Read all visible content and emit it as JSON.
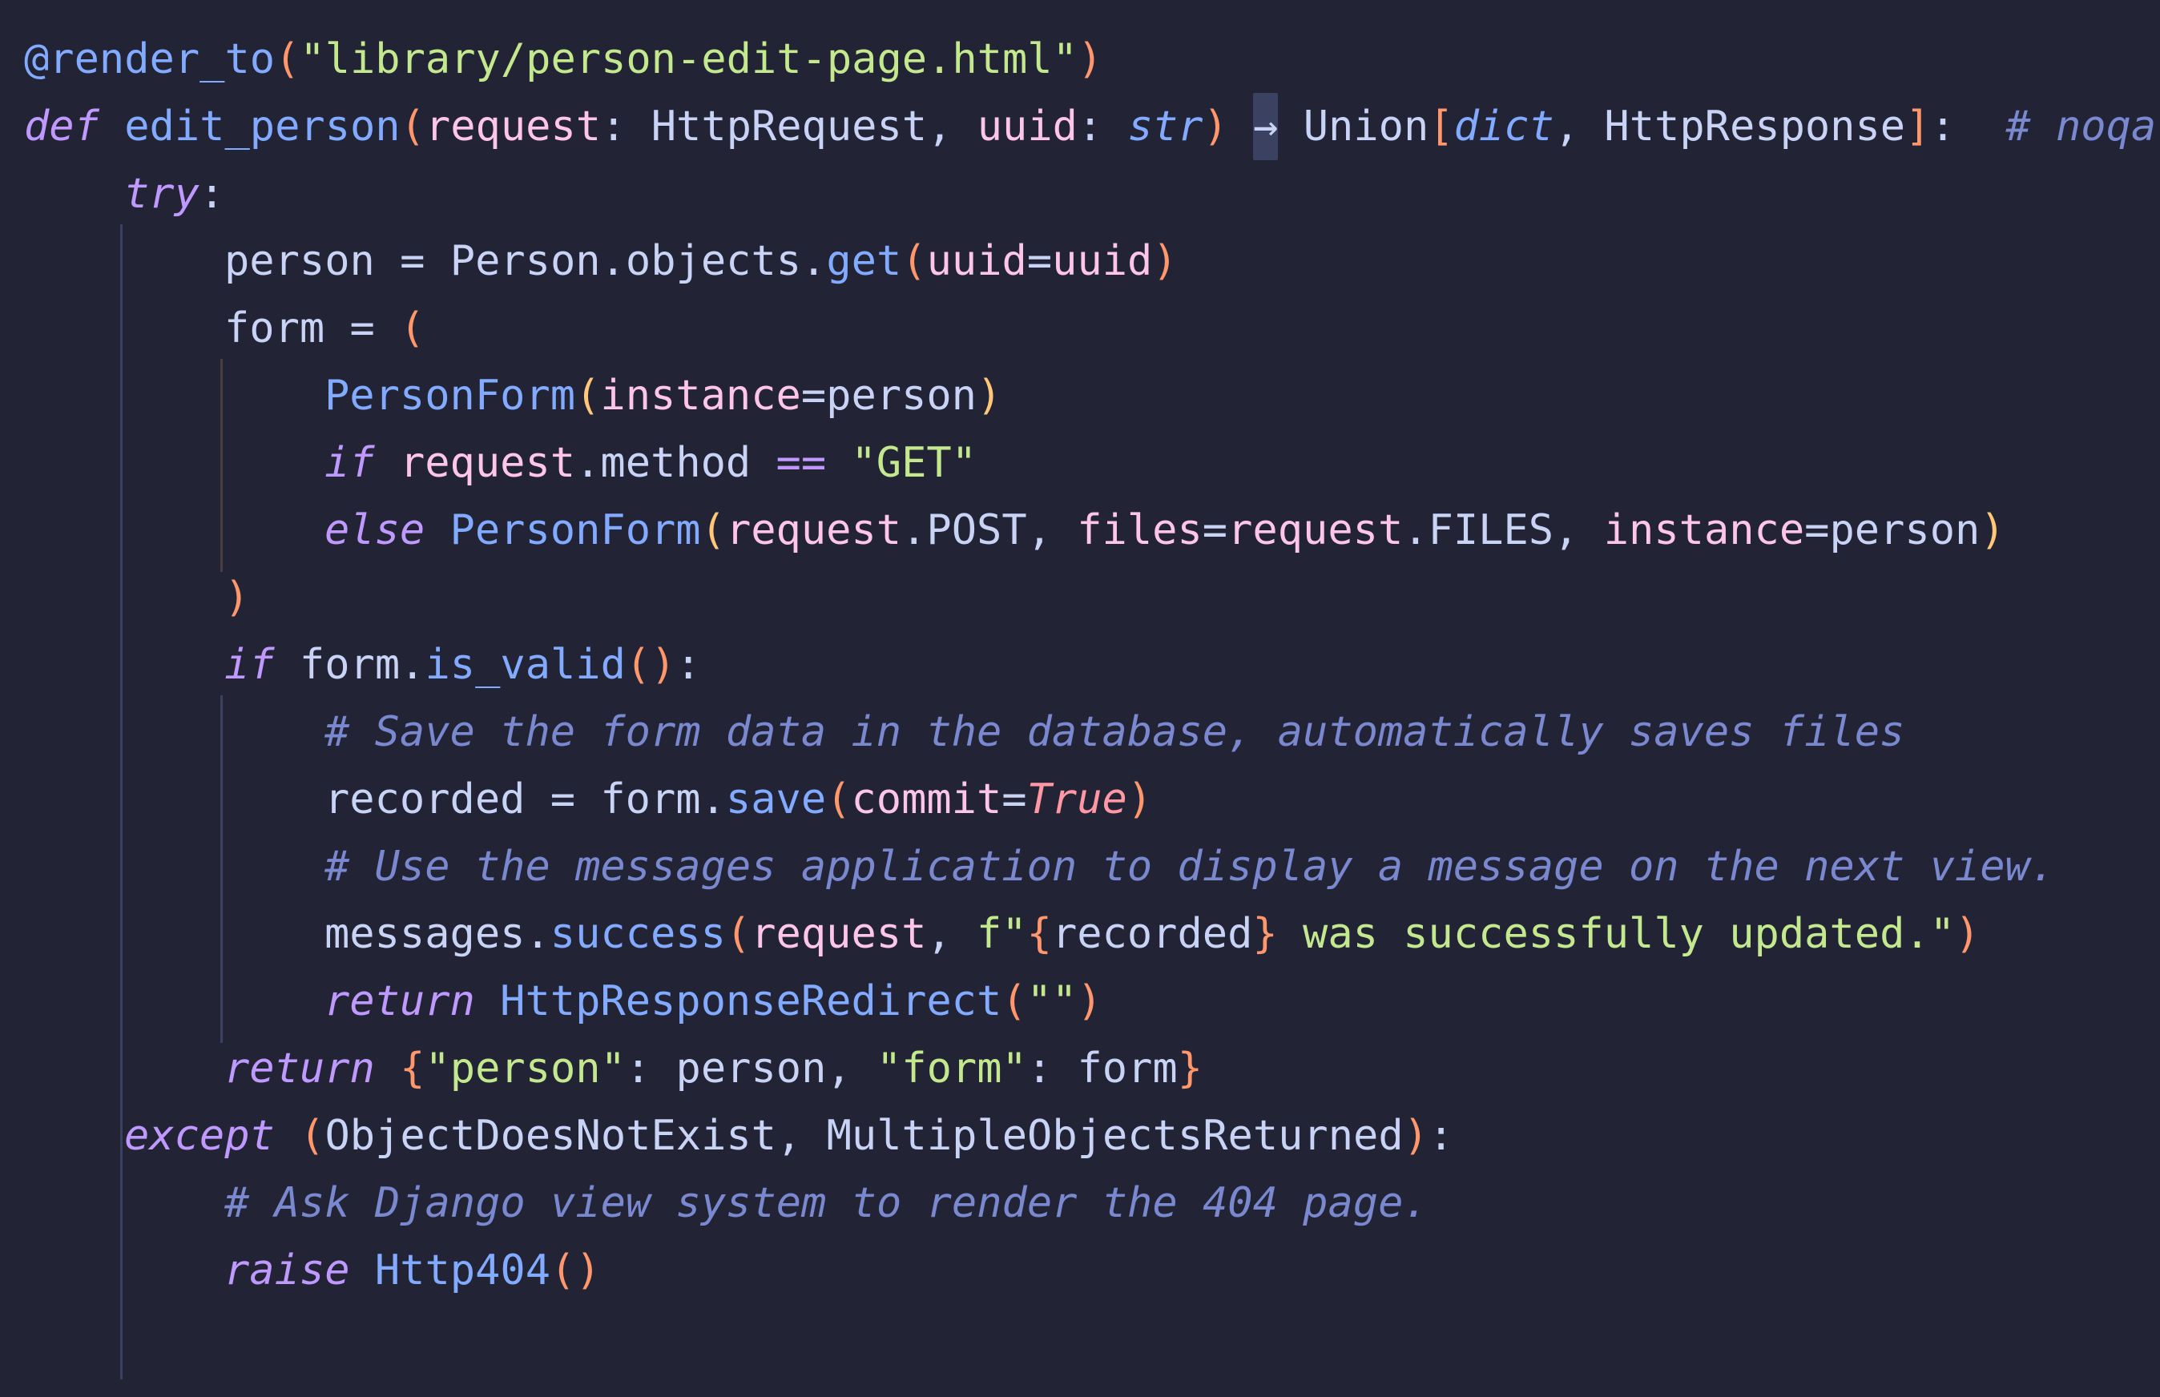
{
  "editor": {
    "language": "python",
    "theme_colors": {
      "background": "#222436",
      "default": "#c8d3f5",
      "keyword": "#c099ff",
      "function": "#82aaff",
      "string": "#c3e88d",
      "punctuation": "#ff966c",
      "parameter": "#fcc5e9",
      "comment": "#7a88cf",
      "bool": "#ff98a4",
      "yellow": "#ffc777"
    },
    "lines": [
      {
        "indent": 0,
        "tokens": [
          {
            "t": "@render_to",
            "c": "func"
          },
          {
            "t": "(",
            "c": "punct"
          },
          {
            "t": "\"library/person-edit-page.html\"",
            "c": "string"
          },
          {
            "t": ")",
            "c": "punct"
          }
        ]
      },
      {
        "indent": 0,
        "tokens": [
          {
            "t": "def",
            "c": "keyword",
            "i": true
          },
          {
            "t": " ",
            "c": "default"
          },
          {
            "t": "edit_person",
            "c": "func"
          },
          {
            "t": "(",
            "c": "punct"
          },
          {
            "t": "request",
            "c": "param"
          },
          {
            "t": ": ",
            "c": "default"
          },
          {
            "t": "HttpRequest",
            "c": "default"
          },
          {
            "t": ", ",
            "c": "default"
          },
          {
            "t": "uuid",
            "c": "param"
          },
          {
            "t": ": ",
            "c": "default"
          },
          {
            "t": "str",
            "c": "type",
            "i": true
          },
          {
            "t": ") ",
            "c": "punct"
          },
          {
            "t": "→",
            "c": "arrow"
          },
          {
            "t": " Union",
            "c": "default"
          },
          {
            "t": "[",
            "c": "punct"
          },
          {
            "t": "dict",
            "c": "type",
            "i": true
          },
          {
            "t": ", HttpResponse",
            "c": "default"
          },
          {
            "t": "]",
            "c": "punct"
          },
          {
            "t": ":  ",
            "c": "default"
          },
          {
            "t": "# noqa",
            "c": "comment",
            "i": true
          }
        ]
      },
      {
        "indent": 1,
        "tokens": [
          {
            "t": "try",
            "c": "keyword",
            "i": true
          },
          {
            "t": ":",
            "c": "default"
          }
        ]
      },
      {
        "indent": 2,
        "tokens": [
          {
            "t": "person = Person.objects.",
            "c": "default"
          },
          {
            "t": "get",
            "c": "func"
          },
          {
            "t": "(",
            "c": "punct"
          },
          {
            "t": "uuid",
            "c": "param"
          },
          {
            "t": "=",
            "c": "default"
          },
          {
            "t": "uuid",
            "c": "param"
          },
          {
            "t": ")",
            "c": "punct"
          }
        ]
      },
      {
        "indent": 2,
        "tokens": [
          {
            "t": "form = ",
            "c": "default"
          },
          {
            "t": "(",
            "c": "punct"
          }
        ]
      },
      {
        "indent": 3,
        "tokens": [
          {
            "t": "PersonForm",
            "c": "func"
          },
          {
            "t": "(",
            "c": "yellow"
          },
          {
            "t": "instance",
            "c": "param"
          },
          {
            "t": "=person",
            "c": "default"
          },
          {
            "t": ")",
            "c": "yellow"
          }
        ]
      },
      {
        "indent": 3,
        "tokens": [
          {
            "t": "if",
            "c": "keyword",
            "i": true
          },
          {
            "t": " ",
            "c": "default"
          },
          {
            "t": "request",
            "c": "param"
          },
          {
            "t": ".method ",
            "c": "default"
          },
          {
            "t": "==",
            "c": "keyword"
          },
          {
            "t": " ",
            "c": "default"
          },
          {
            "t": "\"GET\"",
            "c": "string"
          }
        ]
      },
      {
        "indent": 3,
        "tokens": [
          {
            "t": "else",
            "c": "keyword",
            "i": true
          },
          {
            "t": " ",
            "c": "default"
          },
          {
            "t": "PersonForm",
            "c": "func"
          },
          {
            "t": "(",
            "c": "yellow"
          },
          {
            "t": "request",
            "c": "param"
          },
          {
            "t": ".POST, ",
            "c": "default"
          },
          {
            "t": "files",
            "c": "param"
          },
          {
            "t": "=",
            "c": "default"
          },
          {
            "t": "request",
            "c": "param"
          },
          {
            "t": ".FILES, ",
            "c": "default"
          },
          {
            "t": "instance",
            "c": "param"
          },
          {
            "t": "=person",
            "c": "default"
          },
          {
            "t": ")",
            "c": "yellow"
          }
        ]
      },
      {
        "indent": 2,
        "tokens": [
          {
            "t": ")",
            "c": "punct"
          }
        ]
      },
      {
        "indent": 2,
        "tokens": [
          {
            "t": "if",
            "c": "keyword",
            "i": true
          },
          {
            "t": " form.",
            "c": "default"
          },
          {
            "t": "is_valid",
            "c": "func"
          },
          {
            "t": "()",
            "c": "punct"
          },
          {
            "t": ":",
            "c": "default"
          }
        ]
      },
      {
        "indent": 3,
        "tokens": [
          {
            "t": "# Save the form data in the database, automatically saves files",
            "c": "comment",
            "i": true
          }
        ]
      },
      {
        "indent": 3,
        "tokens": [
          {
            "t": "recorded = form.",
            "c": "default"
          },
          {
            "t": "save",
            "c": "func"
          },
          {
            "t": "(",
            "c": "punct"
          },
          {
            "t": "commit",
            "c": "param"
          },
          {
            "t": "=",
            "c": "default"
          },
          {
            "t": "True",
            "c": "bool",
            "i": true
          },
          {
            "t": ")",
            "c": "punct"
          }
        ]
      },
      {
        "indent": 3,
        "tokens": [
          {
            "t": "# Use the messages application to display a message on the next view.",
            "c": "comment",
            "i": true
          }
        ]
      },
      {
        "indent": 3,
        "tokens": [
          {
            "t": "messages.",
            "c": "default"
          },
          {
            "t": "success",
            "c": "func"
          },
          {
            "t": "(",
            "c": "punct"
          },
          {
            "t": "request",
            "c": "param"
          },
          {
            "t": ", ",
            "c": "default"
          },
          {
            "t": "f\"",
            "c": "string"
          },
          {
            "t": "{",
            "c": "punct"
          },
          {
            "t": "recorded",
            "c": "default"
          },
          {
            "t": "}",
            "c": "punct"
          },
          {
            "t": " was successfully updated.\"",
            "c": "string"
          },
          {
            "t": ")",
            "c": "punct"
          }
        ]
      },
      {
        "indent": 3,
        "tokens": [
          {
            "t": "return",
            "c": "keyword",
            "i": true
          },
          {
            "t": " ",
            "c": "default"
          },
          {
            "t": "HttpResponseRedirect",
            "c": "func"
          },
          {
            "t": "(",
            "c": "punct"
          },
          {
            "t": "\"\"",
            "c": "string"
          },
          {
            "t": ")",
            "c": "punct"
          }
        ]
      },
      {
        "indent": 2,
        "tokens": [
          {
            "t": "return",
            "c": "keyword",
            "i": true
          },
          {
            "t": " ",
            "c": "default"
          },
          {
            "t": "{",
            "c": "punct"
          },
          {
            "t": "\"person\"",
            "c": "string"
          },
          {
            "t": ": person, ",
            "c": "default"
          },
          {
            "t": "\"form\"",
            "c": "string"
          },
          {
            "t": ": form",
            "c": "default"
          },
          {
            "t": "}",
            "c": "punct"
          }
        ]
      },
      {
        "indent": 1,
        "tokens": [
          {
            "t": "except",
            "c": "keyword",
            "i": true
          },
          {
            "t": " ",
            "c": "default"
          },
          {
            "t": "(",
            "c": "punct"
          },
          {
            "t": "ObjectDoesNotExist, MultipleObjectsReturned",
            "c": "default"
          },
          {
            "t": ")",
            "c": "punct"
          },
          {
            "t": ":",
            "c": "default"
          }
        ]
      },
      {
        "indent": 2,
        "tokens": [
          {
            "t": "# Ask Django view system to render the 404 page.",
            "c": "comment",
            "i": true
          }
        ]
      },
      {
        "indent": 2,
        "tokens": [
          {
            "t": "raise",
            "c": "keyword",
            "i": true
          },
          {
            "t": " ",
            "c": "default"
          },
          {
            "t": "Http404",
            "c": "func"
          },
          {
            "t": "()",
            "c": "punct"
          }
        ]
      }
    ]
  }
}
